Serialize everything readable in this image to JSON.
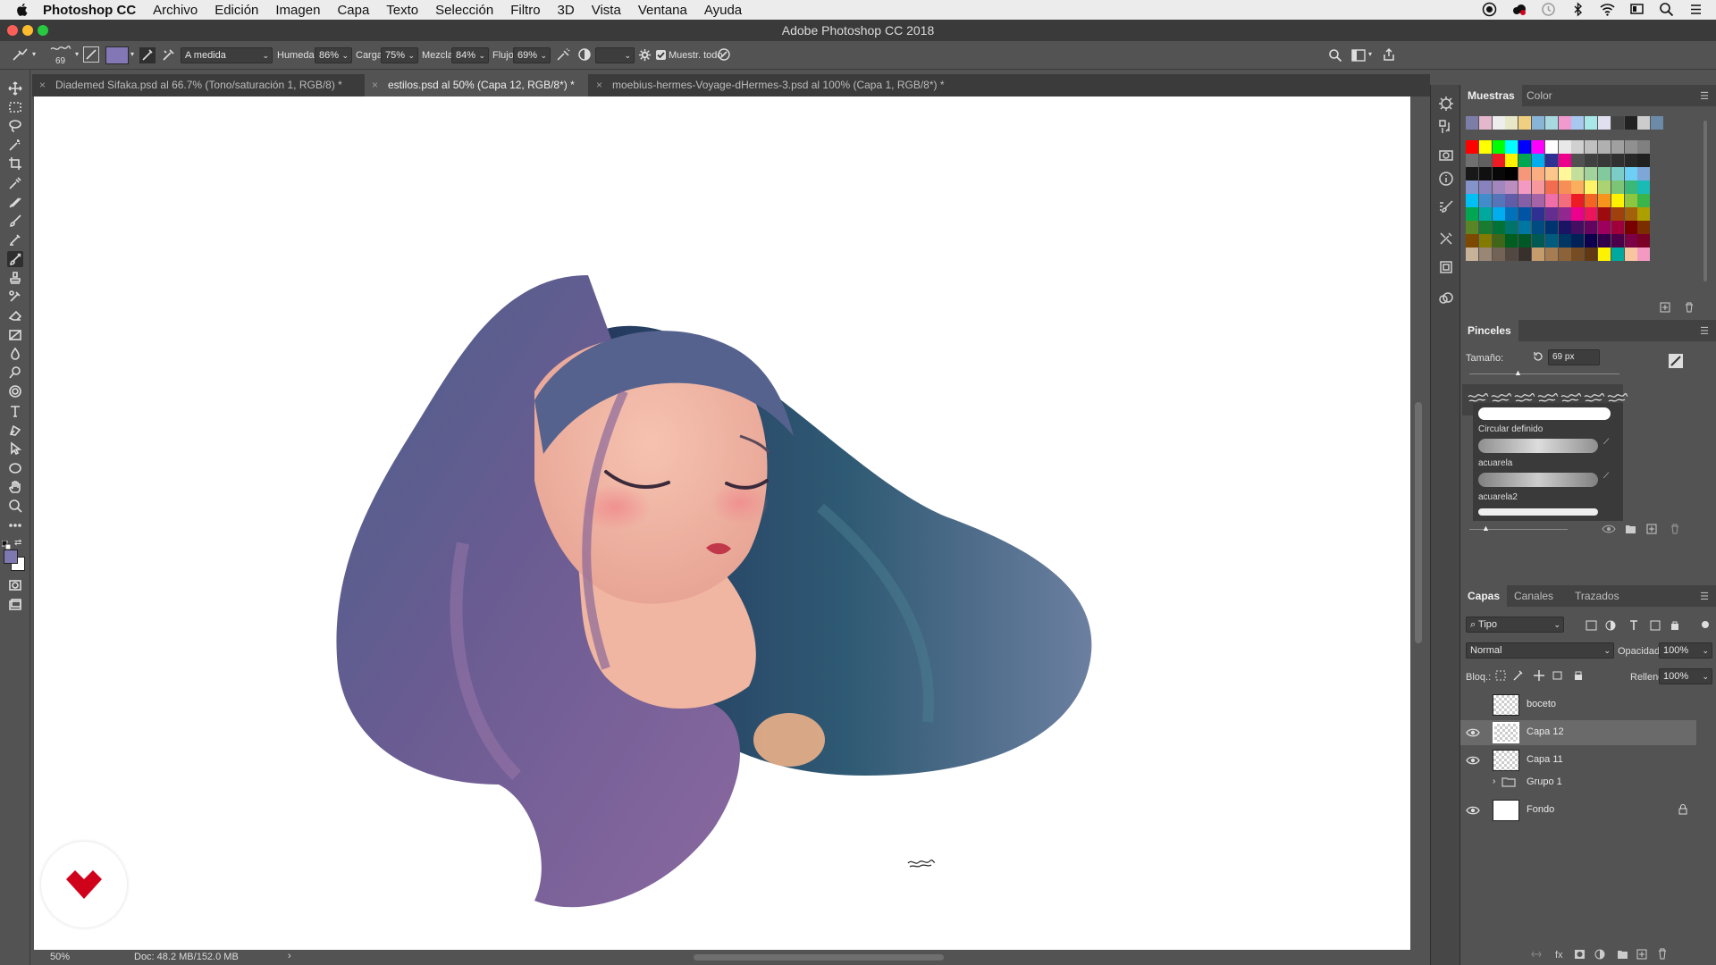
{
  "menubar": {
    "app_name": "Photoshop CC",
    "items": [
      "Archivo",
      "Edición",
      "Imagen",
      "Capa",
      "Texto",
      "Selección",
      "Filtro",
      "3D",
      "Vista",
      "Ventana",
      "Ayuda"
    ]
  },
  "window": {
    "title": "Adobe Photoshop CC 2018"
  },
  "options_bar": {
    "brush_size": "69",
    "preset_select": "A medida",
    "humedad_label": "Humedad:",
    "humedad_value": "86%",
    "carga_label": "Carga:",
    "carga_value": "75%",
    "mezcla_label": "Mezcla:",
    "mezcla_value": "84%",
    "flujo_label": "Flujo:",
    "flujo_value": "69%",
    "muestr_label": "Muestr. todo",
    "brush_color": "#8377b5"
  },
  "tabs": [
    {
      "label": "Diademed Sifaka.psd al 66.7% (Tono/saturación 1, RGB/8) *",
      "active": false
    },
    {
      "label": "estilos.psd al 50% (Capa 12, RGB/8*) *",
      "active": true
    },
    {
      "label": "moebius-hermes-Voyage-dHermes-3.psd al 100% (Capa 1, RGB/8*) *",
      "active": false
    }
  ],
  "status": {
    "zoom": "50%",
    "doc": "Doc: 48.2 MB/152.0 MB",
    "arrow": "›"
  },
  "swatches_panel": {
    "tabs": [
      "Muestras",
      "Color"
    ],
    "recent": [
      "#7d7ea8",
      "#e4b7cc",
      "#eeeeee",
      "#e8e8c8",
      "#f0d080",
      "#88b4d8",
      "#a8d8e0",
      "#f09ad0",
      "#a8c8f0",
      "#a8e8e8",
      "#e0e0f0",
      "#444444",
      "#222222",
      "#cccccc",
      "#6b8ba8"
    ],
    "grid": [
      [
        "#ff0000",
        "#ffff00",
        "#00ff00",
        "#00ffff",
        "#0000ff",
        "#ff00ff",
        "#ffffff",
        "#e8e8e8",
        "#d0d0d0",
        "#c0c0c0",
        "#b0b0b0",
        "#a0a0a0",
        "#909090",
        "#808080"
      ],
      [
        "#707070",
        "#606060",
        "#ed1c24",
        "#fff200",
        "#00a651",
        "#00aeef",
        "#2e3192",
        "#ec008c",
        "#505050",
        "#404040",
        "#383838",
        "#303030",
        "#282828",
        "#202020"
      ],
      [
        "#181818",
        "#101010",
        "#080808",
        "#000000",
        "#f7977a",
        "#f9ad81",
        "#fdc68a",
        "#fff79a",
        "#c4df9b",
        "#a2d39c",
        "#82ca9d",
        "#7bcdc8",
        "#6ecff6",
        "#7ea7d8"
      ],
      [
        "#8493ca",
        "#8882be",
        "#a187be",
        "#bc8dbf",
        "#f49ac2",
        "#f6989d",
        "#f26c4f",
        "#f68e55",
        "#fbaf5c",
        "#fff467",
        "#acd372",
        "#7cc576",
        "#3bb878",
        "#1abbb4"
      ],
      [
        "#00bff3",
        "#438ccb",
        "#5574b9",
        "#605ca8",
        "#855fa8",
        "#a763a8",
        "#f06ea9",
        "#f26d7d",
        "#ed1c24",
        "#f26522",
        "#f7941d",
        "#fff200",
        "#8dc63f",
        "#39b54a"
      ],
      [
        "#00a651",
        "#00a99d",
        "#00aeef",
        "#0072bc",
        "#0054a6",
        "#2e3192",
        "#662d91",
        "#92278f",
        "#ec008c",
        "#ed145b",
        "#9e0b0f",
        "#a0410d",
        "#a3620a",
        "#aba000"
      ],
      [
        "#598527",
        "#197b30",
        "#007236",
        "#00746b",
        "#0076a3",
        "#004b80",
        "#003471",
        "#1b1464",
        "#440e62",
        "#630460",
        "#9e005d",
        "#9e0039",
        "#790000",
        "#7b2e00"
      ],
      [
        "#7d4900",
        "#827b00",
        "#406618",
        "#005e20",
        "#005826",
        "#005952",
        "#005b7f",
        "#003663",
        "#002157",
        "#0d004c",
        "#32004b",
        "#4b0049",
        "#7b0046",
        "#7a0026"
      ],
      [
        "#c7b299",
        "#998675",
        "#736357",
        "#534741",
        "#37302d",
        "#c69c6d",
        "#a67c52",
        "#8c6239",
        "#754c24",
        "#603913",
        "#fff200",
        "#00a99d",
        "#f7c5a0",
        "#f49ac2"
      ]
    ]
  },
  "brushes_panel": {
    "title": "Pinceles",
    "size_label": "Tamaño:",
    "size_value": "69 px",
    "presets": [
      {
        "label": "Circular definido"
      },
      {
        "label": "acuarela"
      },
      {
        "label": "acuarela2"
      }
    ]
  },
  "layers_panel": {
    "tabs": [
      "Capas",
      "Canales",
      "Trazados"
    ],
    "filter": "Tipo",
    "blend_mode": "Normal",
    "opacity_label": "Opacidad:",
    "opacity_value": "100%",
    "lock_label": "Bloq.:",
    "fill_label": "Relleno:",
    "fill_value": "100%",
    "layers": [
      {
        "name": "boceto",
        "visible": false,
        "selected": false
      },
      {
        "name": "Capa 12",
        "visible": true,
        "selected": true
      },
      {
        "name": "Capa 11",
        "visible": true,
        "selected": false
      },
      {
        "name": "Grupo 1",
        "visible": false,
        "selected": false
      },
      {
        "name": "Fondo",
        "visible": true,
        "selected": false
      }
    ]
  },
  "colors": {
    "foreground": "#7d78b0",
    "background": "#ffffff",
    "accent": "#d0021b"
  }
}
